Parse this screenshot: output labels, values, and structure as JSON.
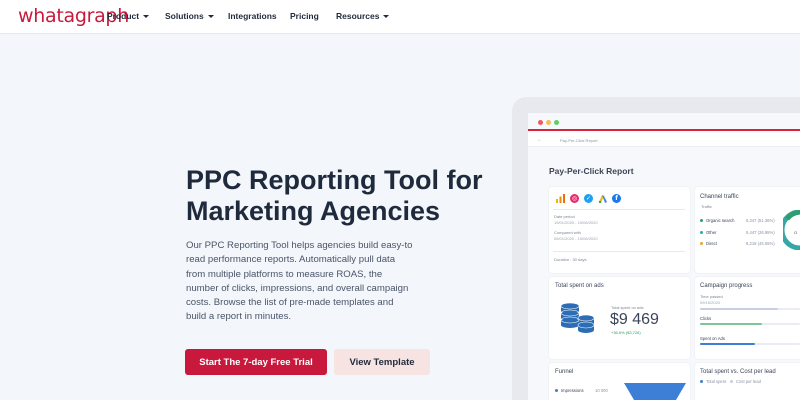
{
  "nav": {
    "logo": "whatagraph",
    "items": [
      {
        "label": "Product",
        "dropdown": true
      },
      {
        "label": "Solutions",
        "dropdown": true
      },
      {
        "label": "Integrations",
        "dropdown": false
      },
      {
        "label": "Pricing",
        "dropdown": false
      },
      {
        "label": "Resources",
        "dropdown": true
      }
    ]
  },
  "hero": {
    "title_line1": "PPC Reporting Tool for",
    "title_line2": "Marketing Agencies",
    "description": "Our PPC Reporting Tool helps agencies build easy-to read performance reports. Automatically pull data from multiple platforms to measure ROAS, the number of clicks, impressions, and overall campaign costs. Browse the list of pre-made templates and build a report in minutes.",
    "primary_button": "Start The 7-day Free Trial",
    "secondary_button": "View Template"
  },
  "mockup": {
    "subnav_back": "←",
    "subnav_title": "Pay-Per-Click Report",
    "report_title": "Pay-Per-Click Report",
    "sources": {
      "icons": [
        "bars-icon",
        "instagram-icon",
        "twitter-icon",
        "google-ads-icon",
        "facebook-icon"
      ],
      "date_period_label": "Date period",
      "date_period_value": "15/01/2020 - 15/06/2020",
      "compared_label": "Compared with",
      "compared_value": "06/01/2020 - 15/06/2020",
      "duration": "Duration : 30 days"
    },
    "channel_traffic": {
      "title": "Channel traffic",
      "subtitle": "Traffic",
      "rows": [
        {
          "label": "Organic search",
          "value": "5,347 (51.36%)",
          "color": "#2f9e6e"
        },
        {
          "label": "Other",
          "value": "5,447 (26.95%)",
          "color": "#35a8a5"
        },
        {
          "label": "Direct",
          "value": "8,218 (45.55%)",
          "color": "#f1a51c"
        }
      ]
    },
    "total_spent": {
      "title": "Total spent on ads",
      "label": "Total spent on ads",
      "value": "$9 469",
      "delta": "+36.6% ($3,726)"
    },
    "campaign_progress": {
      "title": "Campaign progress",
      "time_label": "Time passed",
      "time_value": "09/15/2020",
      "time_progress": 0.78,
      "clicks_label": "Clicks",
      "clicks_progress": 0.62,
      "spent_label": "Spent on Ads",
      "spent_progress": 0.55,
      "colors": {
        "time": "#c9cde4",
        "clicks": "#7fc39b",
        "spent": "#3d7fd6"
      }
    },
    "funnel": {
      "title": "Funnel",
      "row_label": "Impressions",
      "row_value": "10 000"
    },
    "cost_per_lead": {
      "title": "Total spent vs. Cost per lead",
      "legend_a": "Total spent",
      "legend_b": "Cost per lead"
    }
  },
  "colors": {
    "brand": "#c8193c",
    "secondary_button_bg": "#f6e3e2",
    "page_bg": "#f3f6fb"
  }
}
